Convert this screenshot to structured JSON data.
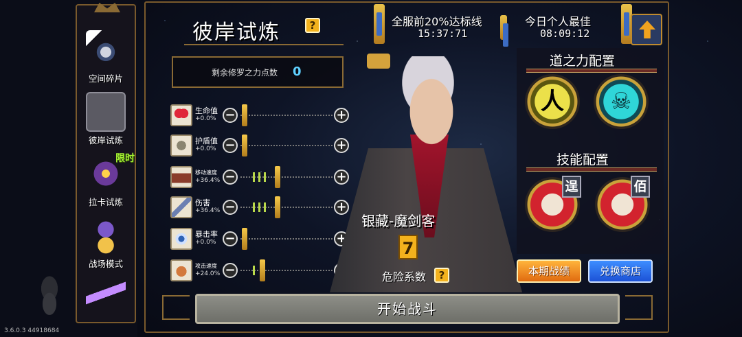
{
  "version": "3.6.0.3 44918684",
  "nav": [
    {
      "label": "空间碎片",
      "icon": "space-fragment-icon"
    },
    {
      "label": "彼岸试炼",
      "icon": "shore-trial-icon",
      "active": true
    },
    {
      "label": "拉卡试炼",
      "icon": "laka-trial-icon",
      "tag": "限时"
    },
    {
      "label": "战场模式",
      "icon": "battlefield-icon"
    },
    {
      "label": "",
      "icon": "lightning-icon"
    }
  ],
  "title": "彼岸试炼",
  "help_mark": "?",
  "top_stats": {
    "server_label": "全服前20%达标线",
    "server_value": "15:37:71",
    "personal_label": "今日个人最佳",
    "personal_value": "08:09:12"
  },
  "points": {
    "label": "剩余修罗之力点数",
    "value": "0"
  },
  "stats": [
    {
      "name": "生命值",
      "value": "+0.0%",
      "icon": "heart-icon",
      "level": 0
    },
    {
      "name": "护盾值",
      "value": "+0.0%",
      "icon": "shield-icon",
      "level": 0
    },
    {
      "name": "移动速度",
      "value": "+36.4%",
      "icon": "boot-icon",
      "level": 3
    },
    {
      "name": "伤害",
      "value": "+36.4%",
      "icon": "sword-icon",
      "level": 3
    },
    {
      "name": "暴击率",
      "value": "+0.0%",
      "icon": "eye-icon",
      "level": 0
    },
    {
      "name": "攻击速度",
      "value": "+24.0%",
      "icon": "glove-icon",
      "level": 2
    }
  ],
  "hero": {
    "name": "银藏-魔剑客",
    "danger_value": "7",
    "danger_label": "危险系数"
  },
  "right": {
    "dao_title": "道之力配置",
    "dao_glyph": "人",
    "skill_title": "技能配置",
    "skill_tag_1": "逞",
    "skill_tag_2": "佰"
  },
  "buttons": {
    "season": "本期战绩",
    "exchange": "兑换商店",
    "start": "开始战斗"
  }
}
